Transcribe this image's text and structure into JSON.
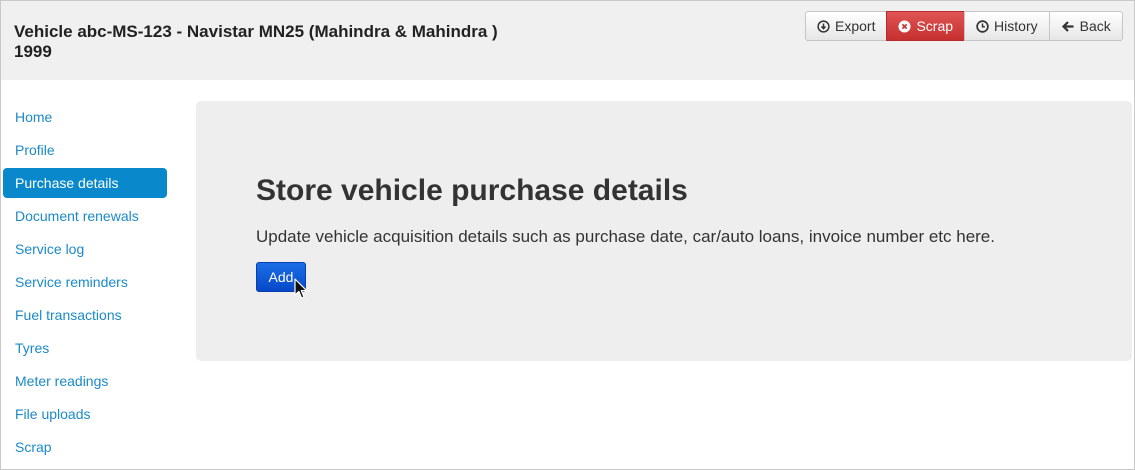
{
  "header": {
    "title_line1": "Vehicle abc-MS-123 - Navistar MN25 (Mahindra & Mahindra )",
    "title_line2": "1999",
    "buttons": [
      {
        "label": "Export",
        "icon": "download-icon"
      },
      {
        "label": "Scrap",
        "icon": "close-circle-icon"
      },
      {
        "label": "History",
        "icon": "clock-icon"
      },
      {
        "label": "Back",
        "icon": "arrow-left-icon"
      }
    ]
  },
  "sidebar": {
    "items": [
      {
        "label": "Home"
      },
      {
        "label": "Profile"
      },
      {
        "label": "Purchase details",
        "active": true
      },
      {
        "label": "Document renewals"
      },
      {
        "label": "Service log"
      },
      {
        "label": "Service reminders"
      },
      {
        "label": "Fuel transactions"
      },
      {
        "label": "Tyres"
      },
      {
        "label": "Meter readings"
      },
      {
        "label": "File uploads"
      },
      {
        "label": "Scrap"
      }
    ]
  },
  "main": {
    "heading": "Store vehicle purchase details",
    "description": "Update vehicle acquisition details such as purchase date, car/auto loans, invoice number etc here.",
    "add_label": "Add"
  },
  "colors": {
    "link": "#1a8ac8",
    "active_nav": "#0a88cc",
    "danger": "#d9534f",
    "primary": "#0a55d6"
  }
}
